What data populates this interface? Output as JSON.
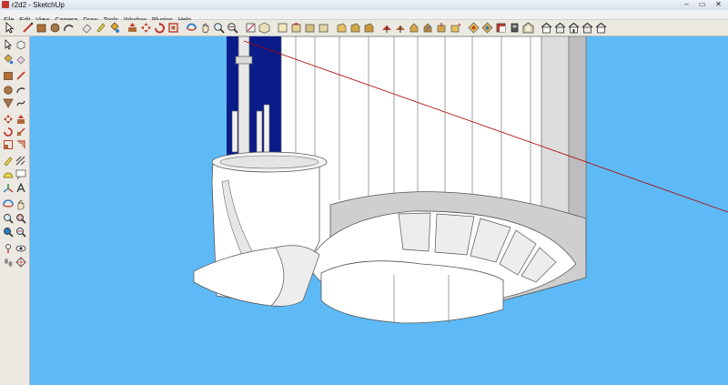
{
  "window": {
    "title": "r2d2 - SketchUp",
    "minimize_glyph": "–",
    "maximize_glyph": "▭",
    "close_glyph": "✕"
  },
  "menu": [
    "File",
    "Edit",
    "View",
    "Camera",
    "Draw",
    "Tools",
    "Window",
    "Plugins",
    "Help"
  ],
  "toolbar_icons": [
    "select-icon",
    "line-icon",
    "rectangle-icon",
    "circle-icon",
    "arc-icon",
    "eraser-icon",
    "tape-measure-icon",
    "paint-bucket-icon",
    "push-pull-icon",
    "move-icon",
    "rotate-icon",
    "offset-icon",
    "orbit-icon",
    "pan-icon",
    "zoom-icon",
    "zoom-extents-icon",
    "section-plane-icon",
    "iso-view-icon",
    "top-view-icon",
    "front-view-icon",
    "right-view-icon",
    "back-view-icon",
    "left-view-icon",
    "x-ray-icon",
    "wireframe-icon",
    "hidden-line-icon",
    "shaded-icon",
    "textured-icon",
    "monochrome-icon",
    "component-icon",
    "group-icon",
    "dimension-icon",
    "text-icon",
    "axes-icon",
    "3d-text-icon",
    "layers-icon",
    "warehouse-icon",
    "share-icon",
    "house-icon",
    "house-outline-icon"
  ],
  "sidebar_icons": [
    "select-icon",
    "component-icon",
    "paint-bucket-icon",
    "eraser-icon",
    "rectangle-icon",
    "line-icon",
    "circle-icon",
    "arc-icon",
    "polygon-icon",
    "freehand-icon",
    "move-icon",
    "push-pull-icon",
    "rotate-icon",
    "follow-me-icon",
    "scale-icon",
    "offset-icon",
    "tape-measure-icon",
    "dimension-icon",
    "protractor-icon",
    "text-icon",
    "axes-icon",
    "3d-text-icon",
    "orbit-icon",
    "pan-icon",
    "zoom-icon",
    "zoom-window-icon",
    "previous-view-icon",
    "zoom-extents-icon",
    "position-camera-icon",
    "look-around-icon",
    "walk-icon",
    "section-plane-icon"
  ],
  "colors": {
    "viewport_bg": "#5ebaf6",
    "model_face": "#ffffff",
    "model_shade": "#d9d9d9",
    "dome_dark_blue": "#0a1c8a",
    "axis_red": "#b00000"
  }
}
